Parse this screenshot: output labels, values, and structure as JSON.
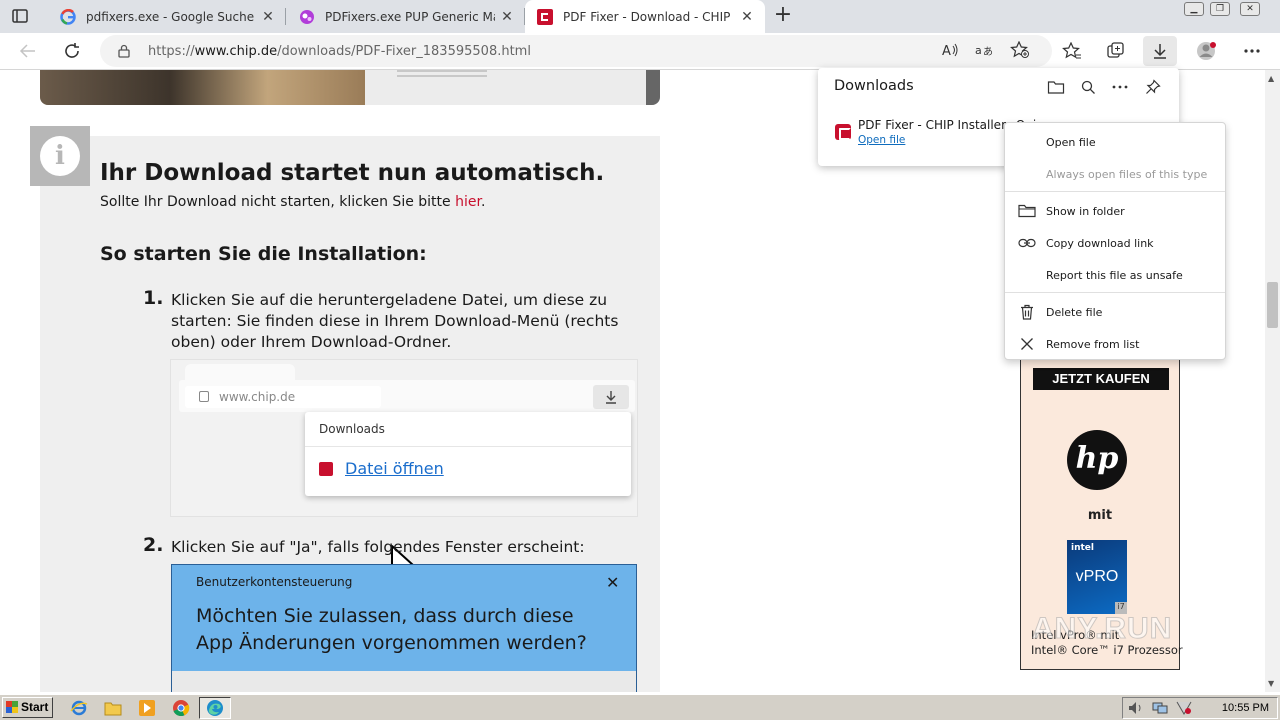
{
  "tabs": [
    {
      "title": "pdfixers.exe - Google Suche",
      "favicon": "google-icon",
      "close": "✕"
    },
    {
      "title": "PDFixers.exe PUP Generic Malwar",
      "favicon": "anyrun-icon",
      "close": "✕"
    },
    {
      "title": "PDF Fixer - Download - CHIP",
      "favicon": "chip-icon",
      "close": "✕",
      "active": true
    }
  ],
  "new_tab_label": "+",
  "address": {
    "url_prefix": "https://",
    "url_domain": "www.chip.de",
    "url_path": "/downloads/PDF-Fixer_183595508.html"
  },
  "page": {
    "heading": "Ihr Download startet nun automatisch.",
    "subtext": "Sollte Ihr Download nicht starten, klicken Sie bitte ",
    "subtext_link": "hier",
    "subtext_end": ".",
    "install_heading": "So starten Sie die Installation:",
    "step1_num": "1.",
    "step1_text": "Klicken Sie auf die heruntergeladene Datei, um diese zu starten: Sie finden diese in Ihrem Download-Menü (rechts oben) oder Ihrem Download-Ordner.",
    "step2_num": "2.",
    "step2_text": "Klicken Sie auf \"Ja\", falls folgendes Fenster erscheint:",
    "illustration1": {
      "address": "www.chip.de",
      "downloads_title": "Downloads",
      "open_link": "Datei öffnen"
    },
    "illustration2": {
      "uac_title": "Benutzerkontensteuerung",
      "uac_close": "✕",
      "uac_question": "Möchten Sie zulassen, dass durch diese App Änderungen vorgenommen  werden?"
    },
    "ad": {
      "buy_button": "JETZT KAUFEN",
      "hp_logo": "hp",
      "mit": "mit",
      "intel_label": "intel",
      "vpro_label": "vPRO",
      "i7_label": "i7",
      "desc_line1": "Intel vPro® mit",
      "desc_line2": "Intel® Core™ i7 Prozessor"
    }
  },
  "downloads_panel": {
    "title": "Downloads",
    "file_name": "PDF Fixer - CHIP Installer _Qui",
    "open_file": "Open file"
  },
  "context_menu": [
    {
      "label": "Open file",
      "icon": "",
      "disabled": false
    },
    {
      "label": "Always open files of this type",
      "icon": "",
      "disabled": true
    },
    {
      "label": "Show in folder",
      "icon": "folder-icon",
      "disabled": false
    },
    {
      "label": "Copy download link",
      "icon": "link-icon",
      "disabled": false
    },
    {
      "label": "Report this file as unsafe",
      "icon": "",
      "disabled": false
    },
    {
      "label": "Delete file",
      "icon": "trash-icon",
      "disabled": false
    },
    {
      "label": "Remove from list",
      "icon": "close-icon",
      "disabled": false
    }
  ],
  "watermark": "ANY.RUN",
  "taskbar": {
    "start_label": "Start",
    "clock": "10:55 PM"
  },
  "colors": {
    "accent_red": "#c8102e",
    "link_blue": "#0f6cbd",
    "uac_blue": "#6db3ea"
  }
}
